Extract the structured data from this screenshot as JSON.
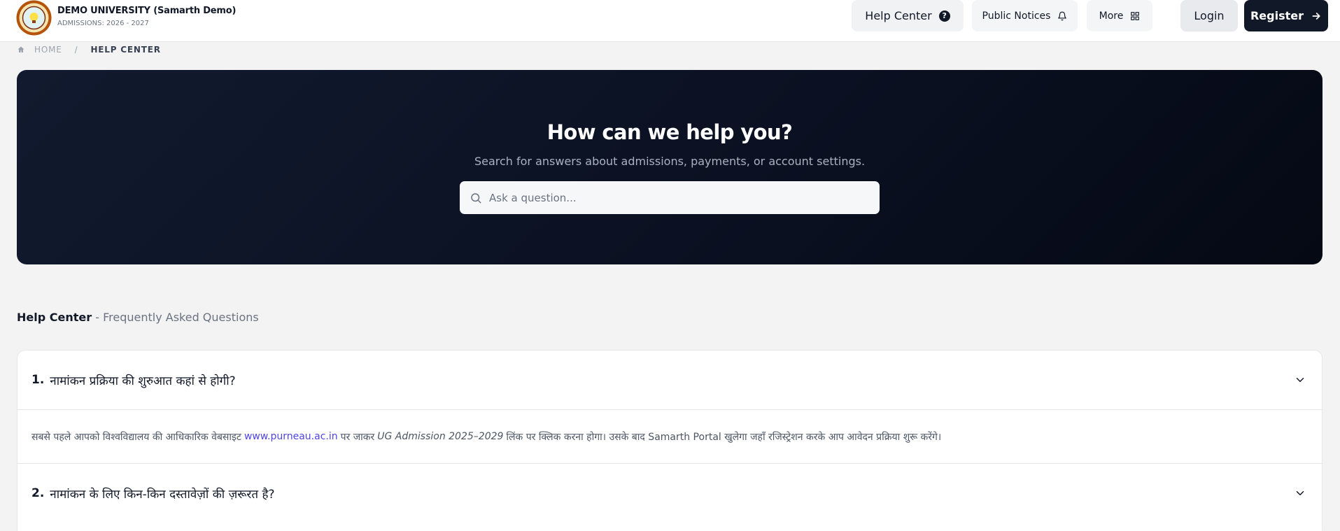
{
  "header": {
    "brand_title": "DEMO UNIVERSITY (Samarth Demo)",
    "brand_sub": "ADMISSIONS: 2026 - 2027",
    "help_center": "Help Center",
    "public_notices": "Public Notices",
    "more": "More",
    "login": "Login",
    "register": "Register"
  },
  "breadcrumb": {
    "home": "HOME",
    "separator": "/",
    "current": "HELP CENTER"
  },
  "hero": {
    "title": "How can we help you?",
    "subtitle": "Search for answers about admissions, payments, or account settings.",
    "search_placeholder": "Ask a question..."
  },
  "faq": {
    "heading_strong": "Help Center",
    "heading_dim": "- Frequently Asked Questions",
    "items": [
      {
        "number": "1.",
        "question": "नामांकन प्रक्रिया की शुरुआत कहां से होगी?",
        "answer_part1": "सबसे पहले आपको विश्वविद्यालय की आधिकारिक वेबसाइट",
        "answer_link": "www.purneau.ac.in",
        "answer_part2": "पर जाकर",
        "answer_em": "UG Admission 2025–2029",
        "answer_part3": "लिंक पर क्लिक करना होगा। उसके बाद Samarth Portal खुलेगा जहाँ रजिस्ट्रेशन करके आप आवेदन प्रक्रिया शुरू करेंगे।"
      },
      {
        "number": "2.",
        "question": "नामांकन के लिए किन-किन दस्तावेज़ों की ज़रूरत है?"
      }
    ]
  },
  "colors": {
    "hero_bg": "#0b1122",
    "accent_dark": "#111827",
    "link": "#4f46e5"
  },
  "icons": {
    "help": "question-circle-icon",
    "notices": "bell-icon",
    "more": "grid-icon",
    "register": "arrow-right-icon",
    "home": "home-icon",
    "search": "search-icon",
    "chevron": "chevron-down-icon"
  }
}
